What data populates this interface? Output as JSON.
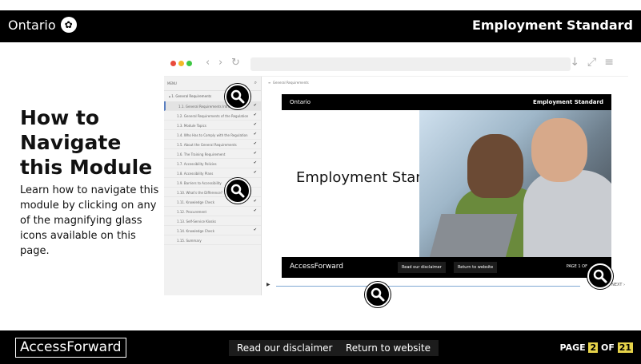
{
  "header": {
    "brand": "Ontario",
    "module_title": "Employment Standard"
  },
  "intro": {
    "heading": "How to Navigate this Module",
    "body": "Learn how to navigate this module by clicking on any of the magnifying glass icons available on this page."
  },
  "browser": {
    "menu_label": "MENU",
    "section": "1. General Requirements",
    "breadcrumb": "General Requirements",
    "menu_items": [
      {
        "label": "1.1. General Requirements Intro",
        "checked": true
      },
      {
        "label": "1.2. General Requirements of the Regulation",
        "checked": true
      },
      {
        "label": "1.3. Module Topics",
        "checked": true
      },
      {
        "label": "1.4. Who Has to Comply with the Regulation",
        "checked": true
      },
      {
        "label": "1.5. About the General Requirements",
        "checked": true
      },
      {
        "label": "1.6. The Training Requirement",
        "checked": true
      },
      {
        "label": "1.7. Accessibility Policies",
        "checked": true
      },
      {
        "label": "1.8. Accessibility Plans",
        "checked": true
      },
      {
        "label": "1.9. Barriers to Accessibility",
        "checked": false
      },
      {
        "label": "1.10. What's the Difference?",
        "checked": false
      },
      {
        "label": "1.11. Knowledge Check",
        "checked": true
      },
      {
        "label": "1.12. Procurement",
        "checked": true
      },
      {
        "label": "1.13. Self-Service Kiosks",
        "checked": false
      },
      {
        "label": "1.14. Knowledge Check",
        "checked": true
      },
      {
        "label": "1.15. Summary",
        "checked": false
      }
    ]
  },
  "slide": {
    "brand": "Ontario",
    "title_top": "Employment Standard",
    "main_title": "Employment Standard",
    "footer_brand": "AccessForward",
    "disclaimer": "Read our disclaimer",
    "website": "Return to website",
    "page": "PAGE 1 OF",
    "next": "NEXT"
  },
  "footer": {
    "brand": "AccessForward",
    "disclaimer": "Read our disclaimer",
    "website": "Return to website",
    "page_prefix": "PAGE",
    "page_current": "2",
    "page_of": "OF",
    "page_total": "21"
  },
  "colors": {
    "bar": "#000000",
    "page_highlight": "#e6d34a",
    "active_menu": "#5a7fc0"
  }
}
